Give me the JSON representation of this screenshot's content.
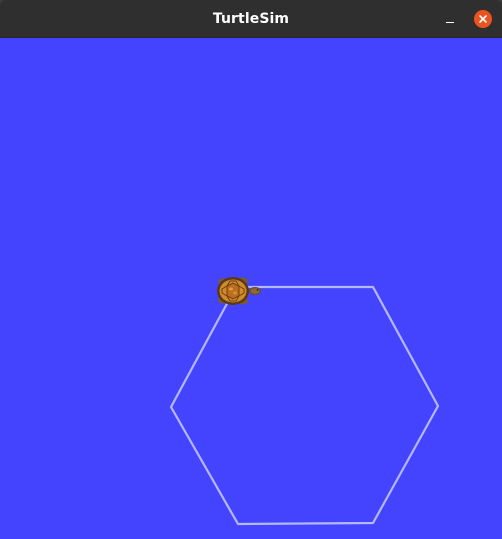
{
  "window": {
    "title": "TurtleSim",
    "buttons": {
      "minimize_icon": "minimize-icon",
      "close_icon": "close-icon",
      "close_color": "#e95420"
    }
  },
  "canvas": {
    "background": "#4444ff",
    "pen_color": "#b3b8ff"
  }
}
